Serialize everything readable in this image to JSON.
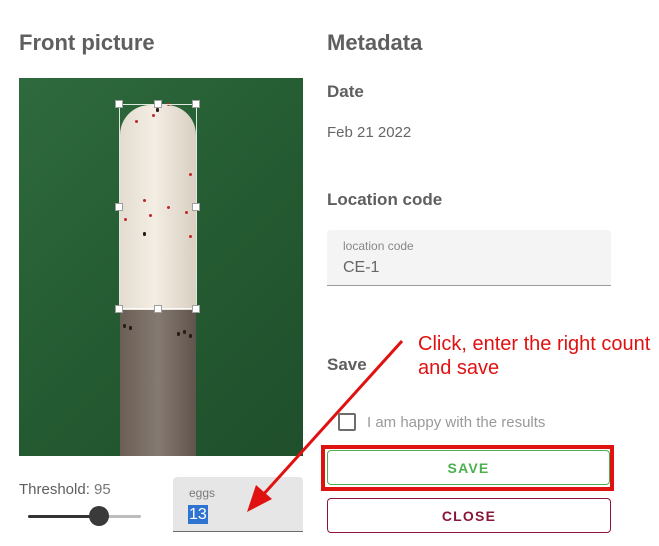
{
  "front": {
    "title": "Front picture",
    "threshold_label": "Threshold:",
    "threshold_value": "95",
    "threshold_level": 0.63,
    "eggs_label": "eggs",
    "eggs_value": "13"
  },
  "metadata": {
    "title": "Metadata",
    "date_title": "Date",
    "date_value": "Feb 21 2022",
    "location_title": "Location code",
    "location_label": "location code",
    "location_value": "CE-1"
  },
  "save_section": {
    "title": "Save",
    "checkbox_label": "I am happy with the results",
    "checkbox_checked": false,
    "save_label": "SAVE",
    "close_label": "CLOSE"
  },
  "annotation": {
    "text": "Click, enter the right count and save",
    "color": "#e01111"
  },
  "colors": {
    "save_green": "#4caf50",
    "close_maroon": "#8b1538",
    "background_green": "#2e6a3d"
  }
}
